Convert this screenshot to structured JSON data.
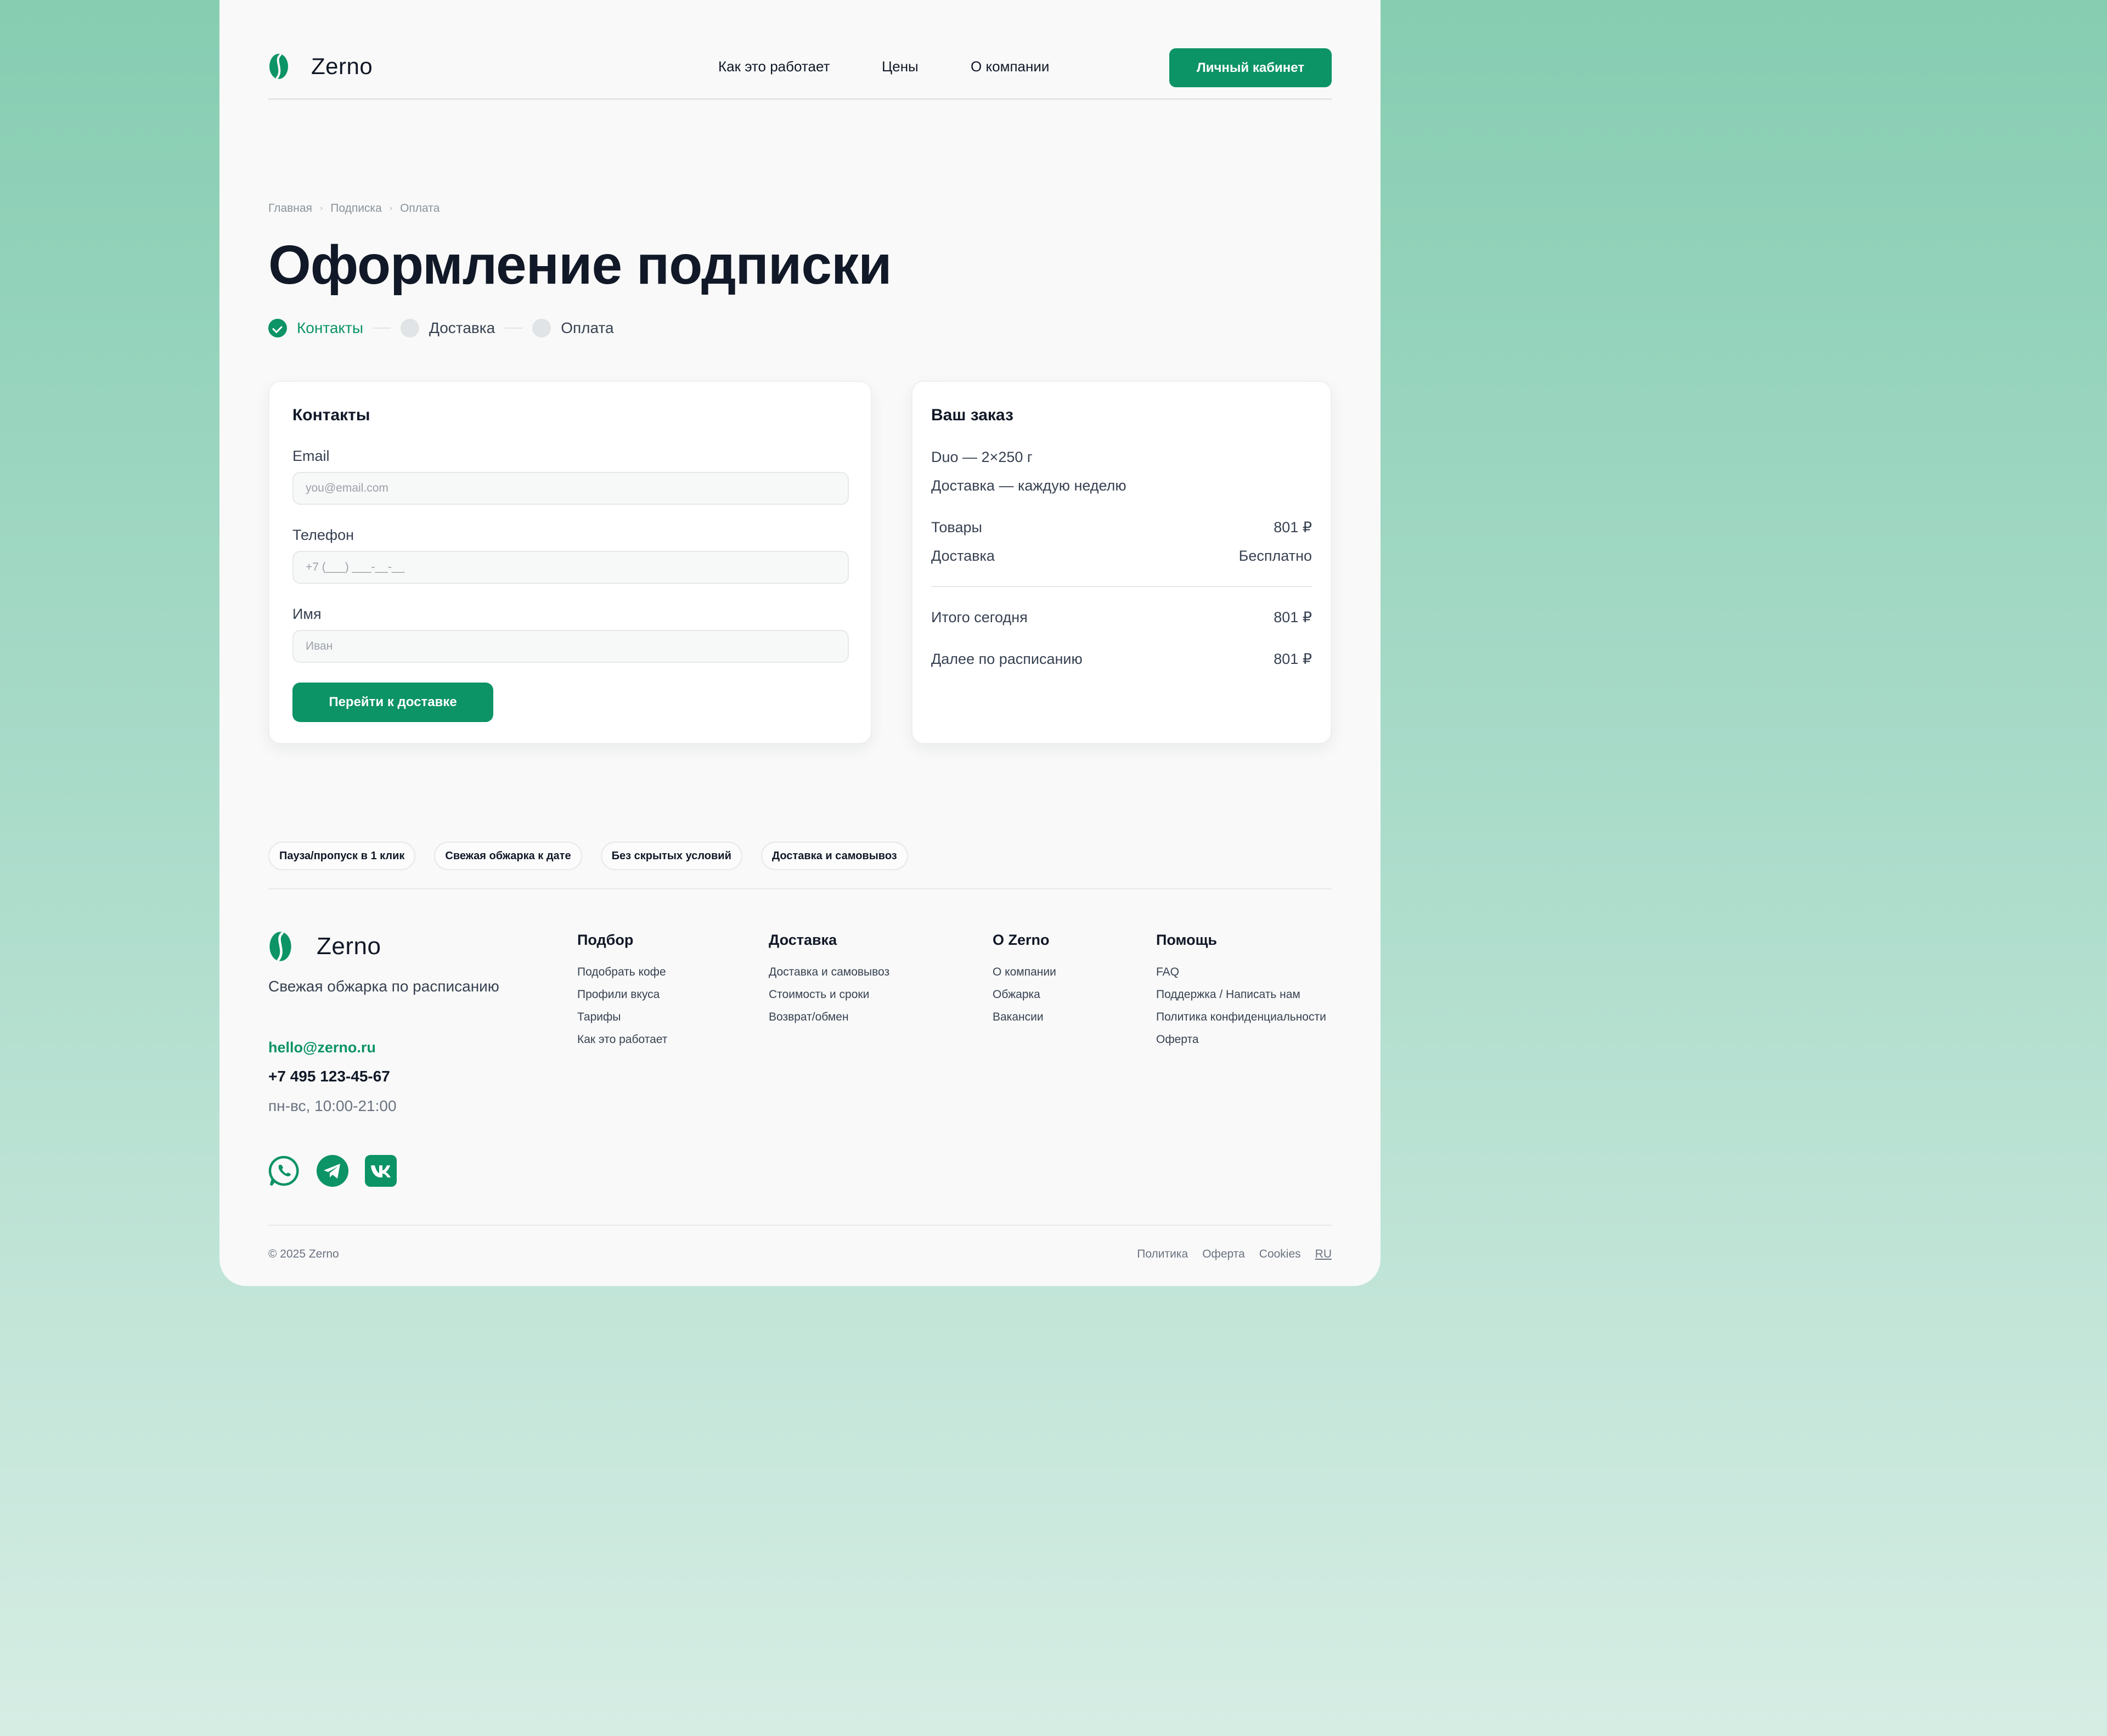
{
  "brand": {
    "name": "Zerno",
    "color": "#0c9366"
  },
  "header": {
    "nav": [
      "Как это работает",
      "Цены",
      "О компании"
    ],
    "cabinet_label": "Личный кабинет"
  },
  "breadcrumb": [
    "Главная",
    "Подписка",
    "Оплата"
  ],
  "page_title": "Оформление подписки",
  "steps": [
    {
      "label": "Контакты",
      "state": "done"
    },
    {
      "label": "Доставка",
      "state": "pending"
    },
    {
      "label": "Оплата",
      "state": "pending"
    }
  ],
  "contacts": {
    "title": "Контакты",
    "email": {
      "label": "Email",
      "value": "",
      "placeholder": "you@email.com"
    },
    "phone": {
      "label": "Телефон",
      "value": "",
      "placeholder": "+7 (___) ___-__-__"
    },
    "name": {
      "label": "Имя",
      "value": "",
      "placeholder": "Иван"
    },
    "next_label": "Перейти к доставке"
  },
  "order": {
    "title": "Ваш заказ",
    "plan": "Duo — 2×250 г",
    "delivery_freq": "Доставка — каждую неделю",
    "goods_label": "Товары",
    "goods_value": "801 ₽",
    "delivery_label": "Доставка",
    "delivery_value": "Бесплатно",
    "total_label": "Итого сегодня",
    "total_value": "801 ₽",
    "next_label": "Далее по расписанию",
    "next_value": "801 ₽"
  },
  "chips": [
    "Пауза/пропуск в 1 клик",
    "Свежая обжарка к дате",
    "Без скрытых условий",
    "Доставка и самовывоз"
  ],
  "footer": {
    "tagline": "Свежая обжарка по расписанию",
    "email": "hello@zerno.ru",
    "phone": "+7 495 123-45-67",
    "hours": "пн-вс, 10:00-21:00",
    "social_icons": [
      "whatsapp-icon",
      "telegram-icon",
      "vk-icon"
    ],
    "columns": [
      {
        "title": "Подбор",
        "links": [
          "Подобрать кофе",
          "Профили вкуса",
          "Тарифы",
          "Как это работает"
        ]
      },
      {
        "title": "Доставка",
        "links": [
          "Доставка и самовывоз",
          "Стоимость и сроки",
          "Возврат/обмен"
        ]
      },
      {
        "title": "О Zerno",
        "links": [
          "О компании",
          "Обжарка",
          "Вакансии"
        ]
      },
      {
        "title": "Помощь",
        "links": [
          "FAQ",
          "Поддержка / Написать нам",
          "Политика конфиденциальности",
          "Оферта"
        ]
      }
    ],
    "copyright": "© 2025 Zerno",
    "bottom_links": [
      "Политика",
      "Оферта",
      "Cookies"
    ],
    "lang": "RU"
  }
}
